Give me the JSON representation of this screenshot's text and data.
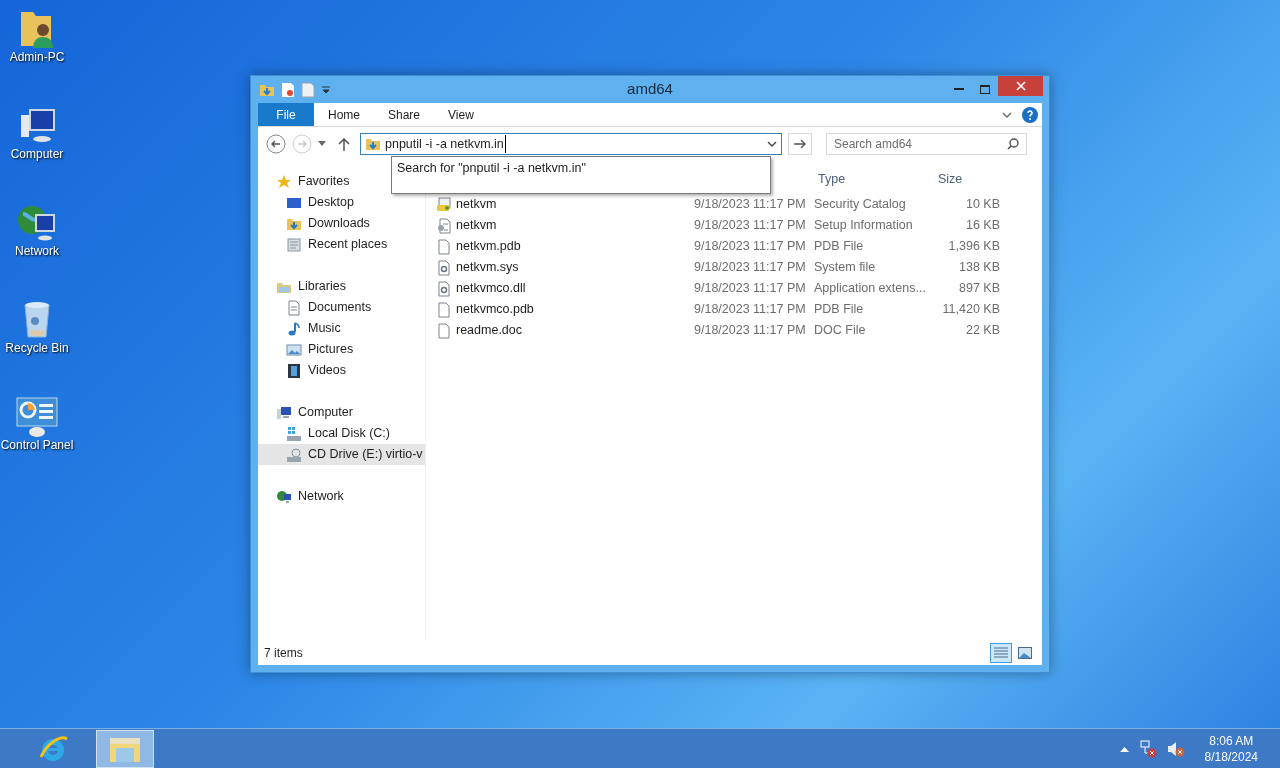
{
  "desktop_icons": [
    {
      "label": "Admin-PC",
      "kind": "user"
    },
    {
      "label": "Computer",
      "kind": "computer"
    },
    {
      "label": "Network",
      "kind": "network"
    },
    {
      "label": "Recycle Bin",
      "kind": "bin"
    },
    {
      "label": "Control Panel",
      "kind": "control"
    }
  ],
  "window": {
    "title": "amd64"
  },
  "ribbon_tabs": [
    {
      "label": "File",
      "kind": "file"
    },
    {
      "label": "Home",
      "kind": "tab"
    },
    {
      "label": "Share",
      "kind": "tab"
    },
    {
      "label": "View",
      "kind": "tab"
    }
  ],
  "address": {
    "value": "pnputil -i -a netkvm.in",
    "suggestion": "Search for \"pnputil -i -a netkvm.in\""
  },
  "search": {
    "placeholder": "Search amd64"
  },
  "sidebar": {
    "groups": [
      {
        "label": "Favorites",
        "kind": "star",
        "selected": false,
        "children": [
          {
            "label": "Desktop",
            "kind": "desktop",
            "selected": false
          },
          {
            "label": "Downloads",
            "kind": "downloads",
            "selected": false
          },
          {
            "label": "Recent places",
            "kind": "recent",
            "selected": false
          }
        ]
      },
      {
        "label": "Libraries",
        "kind": "libraries",
        "selected": false,
        "children": [
          {
            "label": "Documents",
            "kind": "documents",
            "selected": false
          },
          {
            "label": "Music",
            "kind": "music",
            "selected": false
          },
          {
            "label": "Pictures",
            "kind": "pictures",
            "selected": false
          },
          {
            "label": "Videos",
            "kind": "videos",
            "selected": false
          }
        ]
      },
      {
        "label": "Computer",
        "kind": "computer",
        "selected": false,
        "children": [
          {
            "label": "Local Disk (C:)",
            "kind": "disk",
            "selected": false
          },
          {
            "label": "CD Drive (E:) virtio-v",
            "kind": "cd",
            "selected": true
          }
        ]
      },
      {
        "label": "Network",
        "kind": "network",
        "selected": false
      }
    ]
  },
  "table": {
    "columns": [
      "Type",
      "Size"
    ],
    "rows": [
      {
        "name": "netkvm",
        "date": "9/18/2023 11:17 PM",
        "type": "Security Catalog",
        "size": "10 KB",
        "kind": "catalog"
      },
      {
        "name": "netkvm",
        "date": "9/18/2023 11:17 PM",
        "type": "Setup Information",
        "size": "16 KB",
        "kind": "setup"
      },
      {
        "name": "netkvm.pdb",
        "date": "9/18/2023 11:17 PM",
        "type": "PDB File",
        "size": "1,396 KB",
        "kind": "blank"
      },
      {
        "name": "netkvm.sys",
        "date": "9/18/2023 11:17 PM",
        "type": "System file",
        "size": "138 KB",
        "kind": "system"
      },
      {
        "name": "netkvmco.dll",
        "date": "9/18/2023 11:17 PM",
        "type": "Application extens...",
        "size": "897 KB",
        "kind": "system"
      },
      {
        "name": "netkvmco.pdb",
        "date": "9/18/2023 11:17 PM",
        "type": "PDB File",
        "size": "11,420 KB",
        "kind": "blank"
      },
      {
        "name": "readme.doc",
        "date": "9/18/2023 11:17 PM",
        "type": "DOC File",
        "size": "22 KB",
        "kind": "blank"
      }
    ]
  },
  "status_bar": {
    "text": "7 items",
    "views": [
      {
        "kind": "details",
        "selected": true
      },
      {
        "kind": "large",
        "selected": false
      }
    ]
  },
  "taskbar": {
    "apps": [
      {
        "kind": "browser",
        "selected": false
      },
      {
        "kind": "explorer",
        "selected": true
      }
    ],
    "time": "8:06 AM",
    "date": "8/18/2024"
  }
}
